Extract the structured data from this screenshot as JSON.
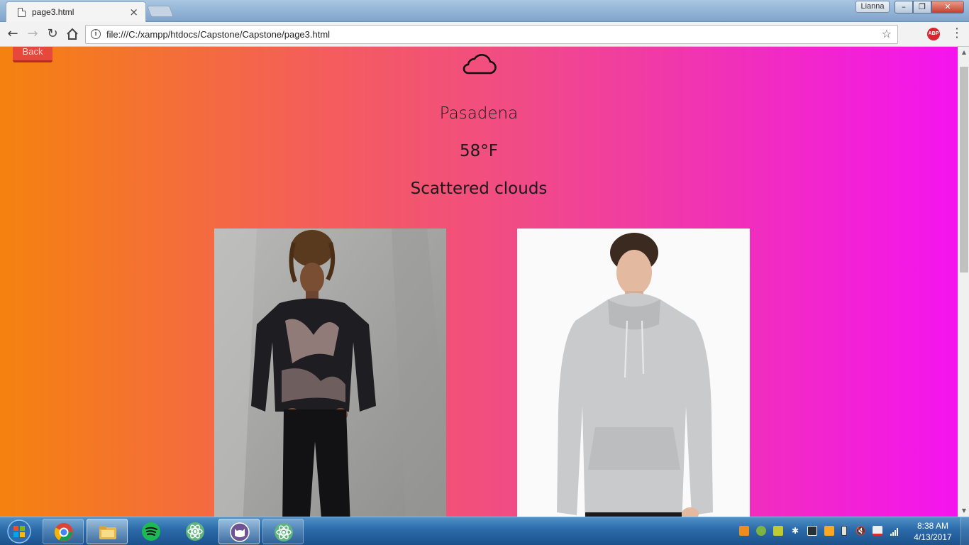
{
  "browser": {
    "tab_title": "page3.html",
    "tab_close": "×",
    "user_name": "Lianna",
    "url": "file:///C:/xampp/htdocs/Capstone/Capstone/page3.html",
    "extension_label": "ABP"
  },
  "page": {
    "back_label": "Back",
    "weather_icon": "cloud-icon",
    "city": "Pasadena",
    "temperature": "58°F",
    "description": "Scattered clouds",
    "outfit_images": [
      "tie-dye-sweatshirt-photo",
      "grey-hoodie-photo"
    ]
  },
  "taskbar": {
    "apps": [
      "chrome",
      "file-explorer",
      "spotify",
      "atom",
      "github-desktop",
      "atom"
    ],
    "time": "8:38 AM",
    "date": "4/13/2017"
  },
  "colors": {
    "gradient_left": "#f5820f",
    "gradient_right": "#f414ef",
    "back_button": "#e8473c"
  }
}
